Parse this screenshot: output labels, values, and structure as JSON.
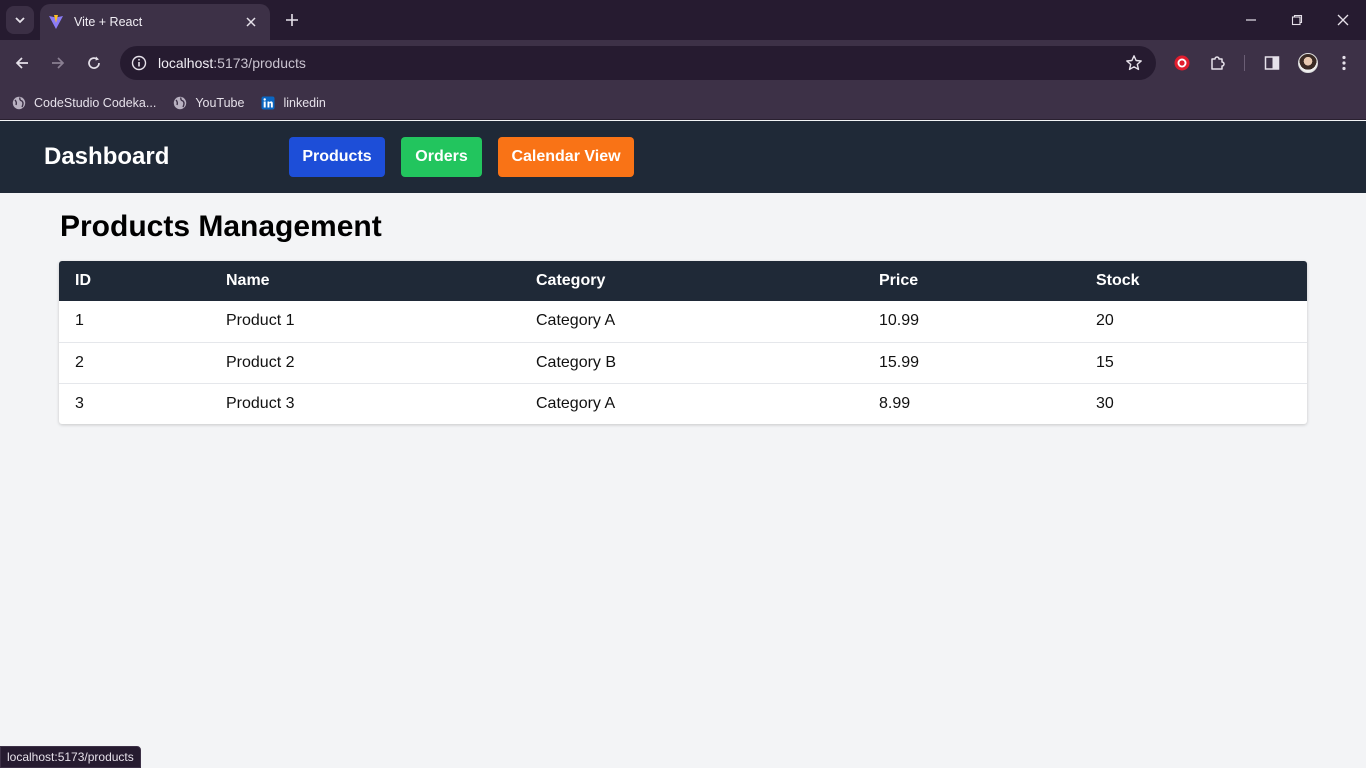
{
  "browser": {
    "tab_title": "Vite + React",
    "url_host": "localhost",
    "url_path": ":5173/products",
    "bookmarks": [
      {
        "label": "CodeStudio Codeka...",
        "icon": "globe-icon"
      },
      {
        "label": "YouTube",
        "icon": "globe-icon"
      },
      {
        "label": "linkedin",
        "icon": "linkedin-icon"
      }
    ],
    "status_url": "localhost:5173/products"
  },
  "header": {
    "brand": "Dashboard",
    "nav": [
      {
        "label": "Products",
        "color": "#1d4ed8"
      },
      {
        "label": "Orders",
        "color": "#22c55e"
      },
      {
        "label": "Calendar View",
        "color": "#f97316"
      }
    ]
  },
  "main": {
    "title": "Products Management",
    "table": {
      "columns": [
        "ID",
        "Name",
        "Category",
        "Price",
        "Stock"
      ],
      "rows": [
        [
          "1",
          "Product 1",
          "Category A",
          "10.99",
          "20"
        ],
        [
          "2",
          "Product 2",
          "Category B",
          "15.99",
          "15"
        ],
        [
          "3",
          "Product 3",
          "Category A",
          "8.99",
          "30"
        ]
      ]
    }
  },
  "colors": {
    "header_bg": "#1f2937",
    "page_bg": "#f3f4f6"
  }
}
